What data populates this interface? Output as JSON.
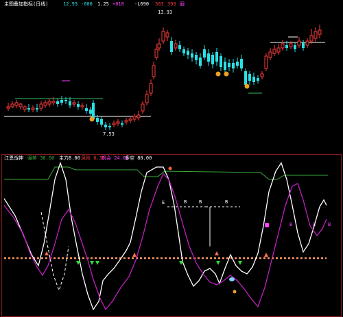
{
  "colors": {
    "up": "#ff3b3b",
    "down": "#29e0e6",
    "ref_line": "#ffffff",
    "resistance": "#2fbf6a",
    "baseline": "#ff9a6a",
    "k_line": "#ffffff",
    "d_line": "#c020c0",
    "upper_band": "#3aaa3a",
    "panel_border": "#8b1a1a",
    "accent_yellow": "#f0c020",
    "marker_magenta": "#ff40ff"
  },
  "top_header": {
    "title": "主图叠加指标(日线)",
    "v1": "12.93",
    "v2": "-600",
    "v3": "1.25",
    "v4": "+018",
    "v5": "-L690",
    "v6": "383",
    "v7": "393",
    "v8": "弱"
  },
  "price_labels": {
    "high": "13.93",
    "low": "7.53"
  },
  "bottom_header": {
    "title": "江恩战神",
    "f1": "强势 30.00",
    "f2": "主力",
    "f3": "8.00",
    "f4": "风险 6.30",
    "f5": "机会 24.00",
    "f6": "多空 80.00"
  },
  "osc_labels": {
    "e": "E",
    "b1": "B",
    "b2": "B",
    "b3": "B",
    "b4": "B",
    "b5": "B",
    "b6": "B"
  }
}
